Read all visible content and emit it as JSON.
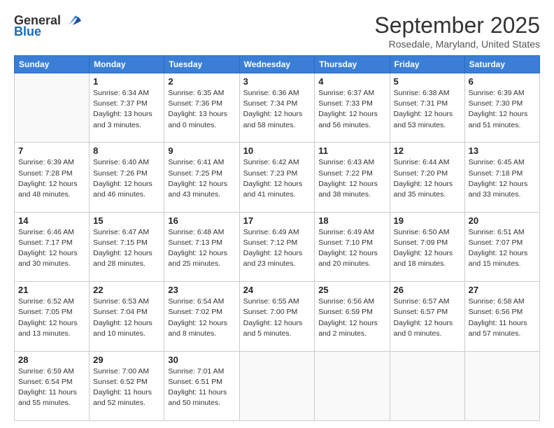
{
  "header": {
    "logo_general": "General",
    "logo_blue": "Blue",
    "month": "September 2025",
    "location": "Rosedale, Maryland, United States"
  },
  "days_of_week": [
    "Sunday",
    "Monday",
    "Tuesday",
    "Wednesday",
    "Thursday",
    "Friday",
    "Saturday"
  ],
  "weeks": [
    [
      {
        "day": "",
        "info": ""
      },
      {
        "day": "1",
        "info": "Sunrise: 6:34 AM\nSunset: 7:37 PM\nDaylight: 13 hours\nand 3 minutes."
      },
      {
        "day": "2",
        "info": "Sunrise: 6:35 AM\nSunset: 7:36 PM\nDaylight: 13 hours\nand 0 minutes."
      },
      {
        "day": "3",
        "info": "Sunrise: 6:36 AM\nSunset: 7:34 PM\nDaylight: 12 hours\nand 58 minutes."
      },
      {
        "day": "4",
        "info": "Sunrise: 6:37 AM\nSunset: 7:33 PM\nDaylight: 12 hours\nand 56 minutes."
      },
      {
        "day": "5",
        "info": "Sunrise: 6:38 AM\nSunset: 7:31 PM\nDaylight: 12 hours\nand 53 minutes."
      },
      {
        "day": "6",
        "info": "Sunrise: 6:39 AM\nSunset: 7:30 PM\nDaylight: 12 hours\nand 51 minutes."
      }
    ],
    [
      {
        "day": "7",
        "info": "Sunrise: 6:39 AM\nSunset: 7:28 PM\nDaylight: 12 hours\nand 48 minutes."
      },
      {
        "day": "8",
        "info": "Sunrise: 6:40 AM\nSunset: 7:26 PM\nDaylight: 12 hours\nand 46 minutes."
      },
      {
        "day": "9",
        "info": "Sunrise: 6:41 AM\nSunset: 7:25 PM\nDaylight: 12 hours\nand 43 minutes."
      },
      {
        "day": "10",
        "info": "Sunrise: 6:42 AM\nSunset: 7:23 PM\nDaylight: 12 hours\nand 41 minutes."
      },
      {
        "day": "11",
        "info": "Sunrise: 6:43 AM\nSunset: 7:22 PM\nDaylight: 12 hours\nand 38 minutes."
      },
      {
        "day": "12",
        "info": "Sunrise: 6:44 AM\nSunset: 7:20 PM\nDaylight: 12 hours\nand 35 minutes."
      },
      {
        "day": "13",
        "info": "Sunrise: 6:45 AM\nSunset: 7:18 PM\nDaylight: 12 hours\nand 33 minutes."
      }
    ],
    [
      {
        "day": "14",
        "info": "Sunrise: 6:46 AM\nSunset: 7:17 PM\nDaylight: 12 hours\nand 30 minutes."
      },
      {
        "day": "15",
        "info": "Sunrise: 6:47 AM\nSunset: 7:15 PM\nDaylight: 12 hours\nand 28 minutes."
      },
      {
        "day": "16",
        "info": "Sunrise: 6:48 AM\nSunset: 7:13 PM\nDaylight: 12 hours\nand 25 minutes."
      },
      {
        "day": "17",
        "info": "Sunrise: 6:49 AM\nSunset: 7:12 PM\nDaylight: 12 hours\nand 23 minutes."
      },
      {
        "day": "18",
        "info": "Sunrise: 6:49 AM\nSunset: 7:10 PM\nDaylight: 12 hours\nand 20 minutes."
      },
      {
        "day": "19",
        "info": "Sunrise: 6:50 AM\nSunset: 7:09 PM\nDaylight: 12 hours\nand 18 minutes."
      },
      {
        "day": "20",
        "info": "Sunrise: 6:51 AM\nSunset: 7:07 PM\nDaylight: 12 hours\nand 15 minutes."
      }
    ],
    [
      {
        "day": "21",
        "info": "Sunrise: 6:52 AM\nSunset: 7:05 PM\nDaylight: 12 hours\nand 13 minutes."
      },
      {
        "day": "22",
        "info": "Sunrise: 6:53 AM\nSunset: 7:04 PM\nDaylight: 12 hours\nand 10 minutes."
      },
      {
        "day": "23",
        "info": "Sunrise: 6:54 AM\nSunset: 7:02 PM\nDaylight: 12 hours\nand 8 minutes."
      },
      {
        "day": "24",
        "info": "Sunrise: 6:55 AM\nSunset: 7:00 PM\nDaylight: 12 hours\nand 5 minutes."
      },
      {
        "day": "25",
        "info": "Sunrise: 6:56 AM\nSunset: 6:59 PM\nDaylight: 12 hours\nand 2 minutes."
      },
      {
        "day": "26",
        "info": "Sunrise: 6:57 AM\nSunset: 6:57 PM\nDaylight: 12 hours\nand 0 minutes."
      },
      {
        "day": "27",
        "info": "Sunrise: 6:58 AM\nSunset: 6:56 PM\nDaylight: 11 hours\nand 57 minutes."
      }
    ],
    [
      {
        "day": "28",
        "info": "Sunrise: 6:59 AM\nSunset: 6:54 PM\nDaylight: 11 hours\nand 55 minutes."
      },
      {
        "day": "29",
        "info": "Sunrise: 7:00 AM\nSunset: 6:52 PM\nDaylight: 11 hours\nand 52 minutes."
      },
      {
        "day": "30",
        "info": "Sunrise: 7:01 AM\nSunset: 6:51 PM\nDaylight: 11 hours\nand 50 minutes."
      },
      {
        "day": "",
        "info": ""
      },
      {
        "day": "",
        "info": ""
      },
      {
        "day": "",
        "info": ""
      },
      {
        "day": "",
        "info": ""
      }
    ]
  ]
}
